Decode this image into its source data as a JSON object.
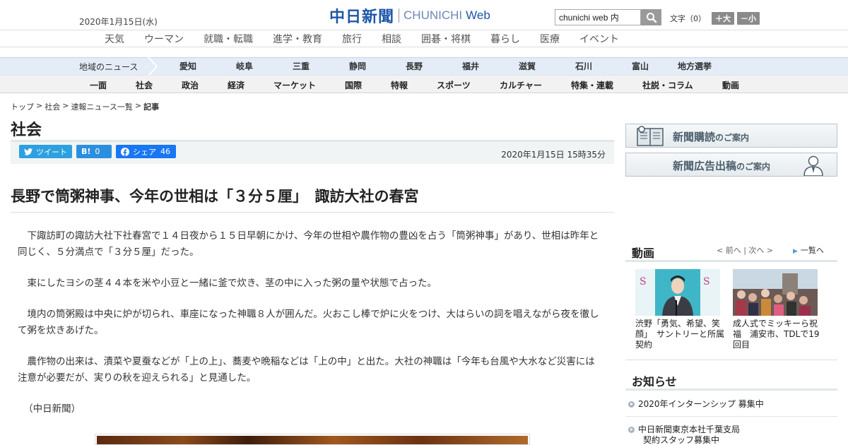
{
  "header": {
    "date": "2020年1月15日(水)",
    "logo_jp": "中日新聞",
    "logo_en": "CHUNICHI",
    "logo_web": "Web",
    "search_value": "chunichi web 内",
    "fontsize_label": "文字（0）",
    "fontsize_up": "＋大",
    "fontsize_down": "－小"
  },
  "service_nav": [
    "天気",
    "ウーマン",
    "就職・転職",
    "進学・教育",
    "旅行",
    "相談",
    "囲碁・将棋",
    "暮らし",
    "医療",
    "イベント"
  ],
  "region_nav": {
    "label": "地域のニュース",
    "items": [
      "愛知",
      "岐阜",
      "三重",
      "静岡",
      "長野",
      "福井",
      "滋賀",
      "石川",
      "富山",
      "地方選挙"
    ]
  },
  "section_nav": [
    "一面",
    "社会",
    "政治",
    "経済",
    "マーケット",
    "国際",
    "特報",
    "スポーツ",
    "カルチャー",
    "特集・連載",
    "社説・コラム",
    "動画"
  ],
  "breadcrumb": {
    "items": [
      "トップ",
      "社会",
      "速報ニュース一覧"
    ],
    "current": "記事",
    "separator": ">"
  },
  "section_title": "社会",
  "share": {
    "tweet_label": "ツイート",
    "hatena_label": "B!",
    "hatena_count": "0",
    "facebook_label": "シェア",
    "facebook_count": "46",
    "published": "2020年1月15日 15時35分"
  },
  "article": {
    "headline": "長野で筒粥神事、今年の世相は「３分５厘」　諏訪大社の春宮",
    "paragraphs": [
      "下諏訪町の諏訪大社下社春宮で１４日夜から１５日早朝にかけ、今年の世相や農作物の豊凶を占う「筒粥神事」があり、世相は昨年と同じく、５分満点で「３分５厘」だった。",
      "束にしたヨシの茎４４本を米や小豆と一緒に釜で炊き、茎の中に入った粥の量や状態で占った。",
      "境内の筒粥殿は中央に炉が切られ、車座になった神職８人が囲んだ。火おこし棒で炉に火をつけ、大はらいの詞を唱えながら夜を徹して粥を炊きあげた。",
      "農作物の出来は、漬菜や夏蚕などが「上の上」、蕎麦や晩稲などは「上の中」と出た。大社の神職は「今年も台風や大水など災害には注意が必要だが、実りの秋を迎えられる」と見通した。"
    ],
    "source": "（中日新聞）"
  },
  "sidebar": {
    "banner1_main": "新聞購読",
    "banner1_sub": "のご案内",
    "banner2_main": "新聞広告出稿",
    "banner2_sub": "のご案内",
    "video": {
      "title": "動画",
      "prev": "前へ",
      "next": "次へ",
      "list_label": "一覧へ",
      "items": [
        {
          "caption": "渋野「勇気、希望、笑顔」　サントリーと所属契約"
        },
        {
          "caption": "成人式でミッキーら祝福　浦安市、TDLで19回目"
        }
      ]
    },
    "info": {
      "title": "お知らせ",
      "items": [
        {
          "line1": "2020年インターンシップ 募集中",
          "line2": ""
        },
        {
          "line1": "中日新聞東京本社千葉支局",
          "line2": "契約スタッフ募集中"
        }
      ]
    }
  },
  "colors": {
    "brand_blue": "#1e56a8",
    "twitter": "#2da0e0",
    "hatena": "#2b8fe0",
    "facebook": "#1877f2",
    "region_bg": "#e3ecf7"
  }
}
